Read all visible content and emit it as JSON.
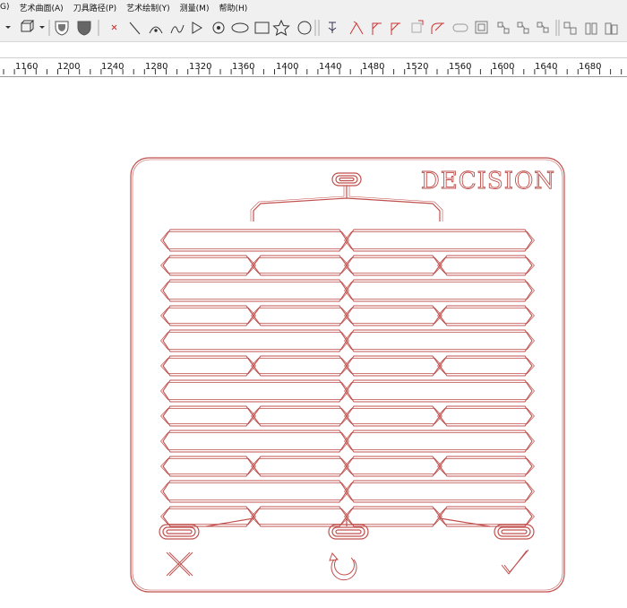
{
  "menu": {
    "items": [
      "G)",
      "艺术曲面(A)",
      "刀具路径(P)",
      "艺术绘制(Y)",
      "测量(M)",
      "帮助(H)"
    ]
  },
  "toolbar": {
    "icons": [
      "dropdown-arrow-icon",
      "3d-box-icon",
      "shield-outline-icon",
      "shield-filled-icon",
      "close-x-icon",
      "line-icon",
      "arc-icon",
      "curve-icon",
      "triangle-icon",
      "circle-dot-icon",
      "ellipse-icon",
      "rectangle-icon",
      "star-icon",
      "circle-icon",
      "tool-a-icon",
      "tool-b-icon",
      "corner-a-icon",
      "corner-b-icon",
      "box-corner-icon",
      "fillet-icon",
      "slot-icon",
      "grid-icon",
      "nodes-a-icon",
      "nodes-b-icon",
      "nodes-c-icon",
      "layout-a-icon",
      "layout-b-icon",
      "layout-c-icon"
    ]
  },
  "ruler": {
    "labels": [
      "1160",
      "1200",
      "1240",
      "1280",
      "1320",
      "1360",
      "1400",
      "1440",
      "1480",
      "1520",
      "1560",
      "1600",
      "1640",
      "1680"
    ]
  },
  "design": {
    "title": "DECISION",
    "stroke_color": "#c0504d",
    "bottom_symbols": [
      "close-x-icon",
      "undo-arrow-icon",
      "checkmark-icon"
    ]
  }
}
